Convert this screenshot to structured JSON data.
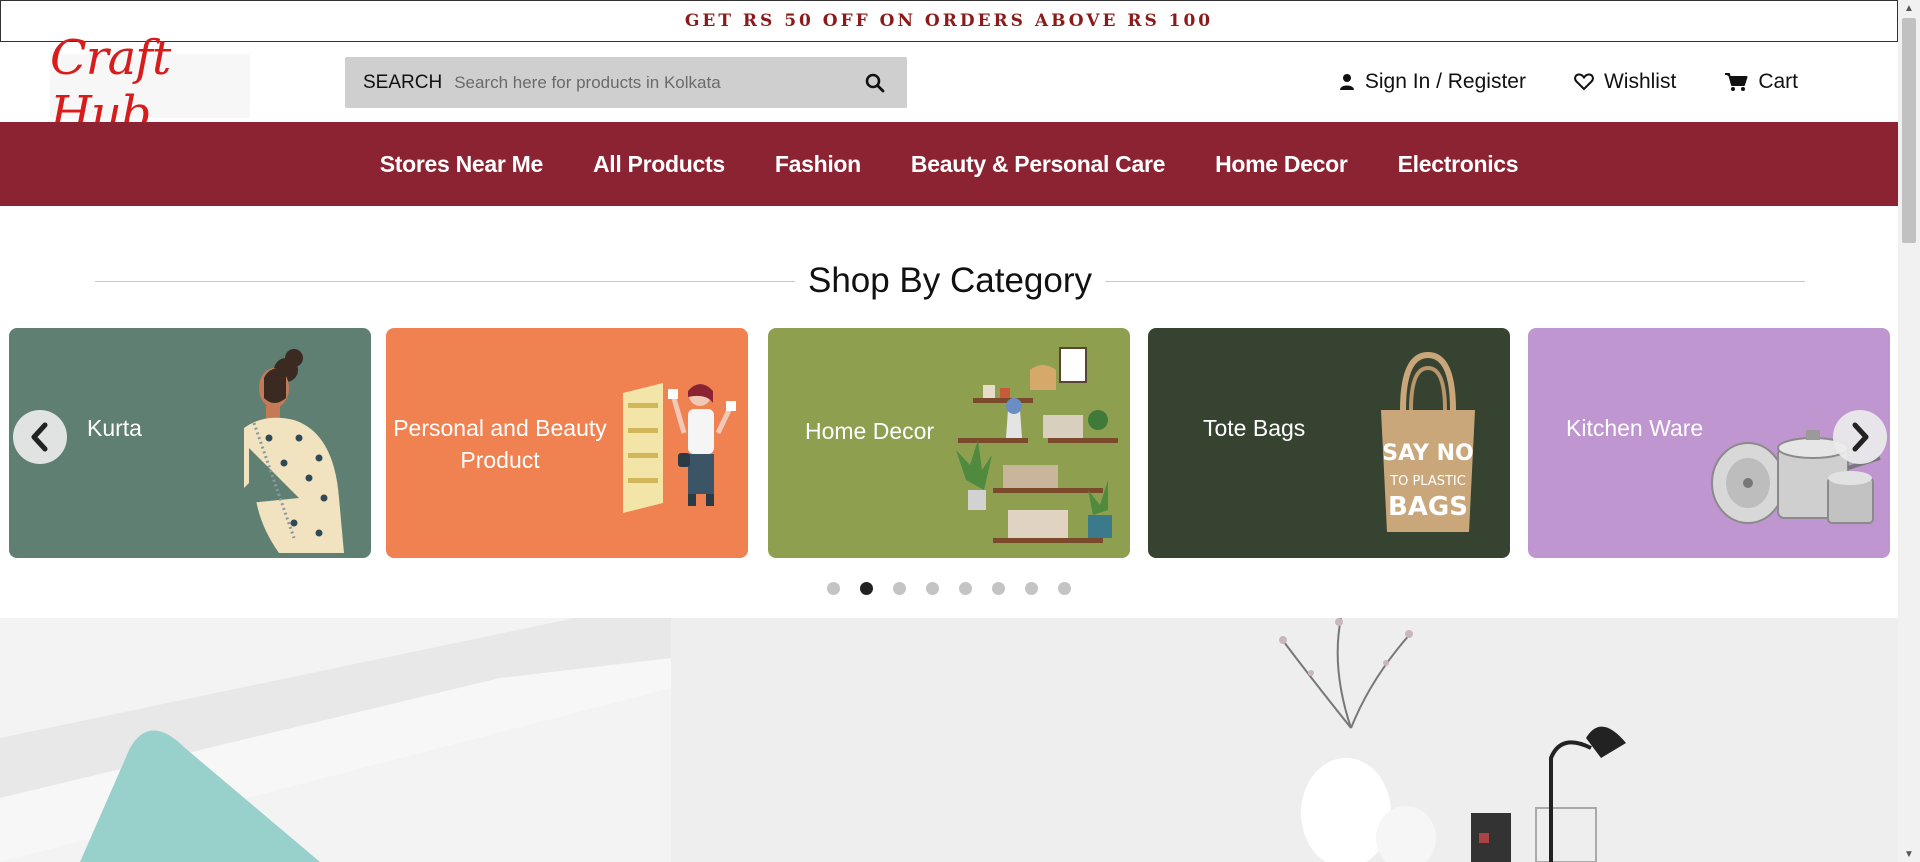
{
  "promo": {
    "text": "GET RS 50 OFF ON ORDERS ABOVE RS 100"
  },
  "header": {
    "logo": "Craft Hub",
    "search": {
      "label": "SEARCH",
      "placeholder": "Search here for products in Kolkata",
      "value": ""
    },
    "links": {
      "signin": "Sign In / Register",
      "wishlist": "Wishlist",
      "cart": "Cart"
    }
  },
  "nav": {
    "items": [
      {
        "label": "Stores Near Me"
      },
      {
        "label": "All Products"
      },
      {
        "label": "Fashion"
      },
      {
        "label": "Beauty & Personal Care"
      },
      {
        "label": "Home Decor"
      },
      {
        "label": "Electronics"
      }
    ]
  },
  "section": {
    "title": "Shop By Category"
  },
  "carousel": {
    "cards": [
      {
        "label": "Kurta",
        "color": "#5f7f73"
      },
      {
        "label": "Personal and Beauty Product",
        "color": "#f08151"
      },
      {
        "label": "Home Decor",
        "color": "#8ea050"
      },
      {
        "label": "Tote Bags",
        "color": "#364331"
      },
      {
        "label": "Kitchen Ware",
        "color": "#bf96d0"
      }
    ],
    "prev_icon": "chevron-left-icon",
    "next_icon": "chevron-right-icon",
    "dots_count": 8,
    "active_dot": 2
  },
  "colors": {
    "brand": "#8b2332",
    "promo_text": "#8b1a1a",
    "logo": "#d81b1b"
  }
}
